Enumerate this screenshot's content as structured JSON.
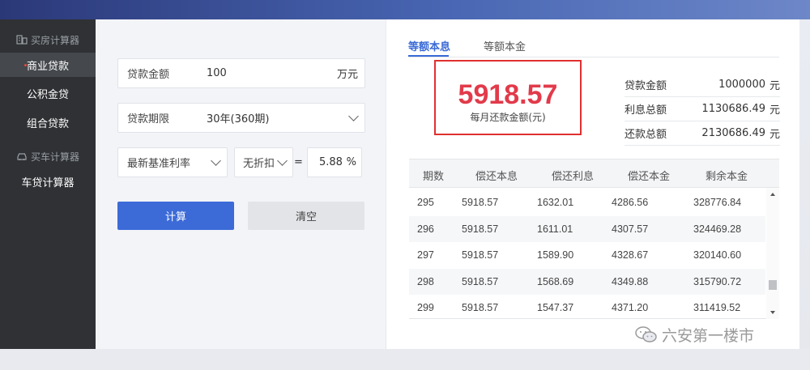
{
  "sidebar": {
    "house_group": {
      "label": "买房计算器",
      "icon": "house-calculator-icon"
    },
    "house_items": [
      {
        "label": "商业贷款"
      },
      {
        "label": "公积金贷"
      },
      {
        "label": "组合贷款"
      }
    ],
    "car_group": {
      "label": "买车计算器",
      "icon": "car-icon"
    },
    "car_items": [
      {
        "label": "车贷计算器"
      }
    ]
  },
  "form": {
    "amount": {
      "label": "贷款金额",
      "value": "100",
      "unit": "万元"
    },
    "term": {
      "label": "贷款期限",
      "value": "30年(360期)"
    },
    "rate_type": {
      "value": "最新基准利率"
    },
    "discount": {
      "value": "无折扣"
    },
    "equals": "=",
    "rate": {
      "value": "5.88",
      "unit": "%"
    },
    "calc_button": "计算",
    "clear_button": "清空"
  },
  "result": {
    "tabs": [
      {
        "label": "等额本息",
        "active": true
      },
      {
        "label": "等额本金",
        "active": false
      }
    ],
    "monthly_payment": "5918.57",
    "monthly_caption": "每月还款金额(元)",
    "summary": [
      {
        "label": "贷款金额",
        "value": "1000000",
        "unit": "元"
      },
      {
        "label": "利息总额",
        "value": "1130686.49",
        "unit": "元"
      },
      {
        "label": "还款总额",
        "value": "2130686.49",
        "unit": "元"
      }
    ],
    "table": {
      "headers": [
        "期数",
        "偿还本息",
        "偿还利息",
        "偿还本金",
        "剩余本金"
      ],
      "rows": [
        [
          "295",
          "5918.57",
          "1632.01",
          "4286.56",
          "328776.84"
        ],
        [
          "296",
          "5918.57",
          "1611.01",
          "4307.57",
          "324469.28"
        ],
        [
          "297",
          "5918.57",
          "1589.90",
          "4328.67",
          "320140.60"
        ],
        [
          "298",
          "5918.57",
          "1568.69",
          "4349.88",
          "315790.72"
        ],
        [
          "299",
          "5918.57",
          "1547.37",
          "4371.20",
          "311419.52"
        ]
      ]
    }
  },
  "watermark": {
    "text": "六安第一楼市",
    "icon": "wechat-icon"
  },
  "colors": {
    "accent_blue": "#3c6bd8",
    "payment_red": "#e23a4a",
    "highlight_box": "#e03030",
    "sidebar_bg": "#2f3134"
  }
}
